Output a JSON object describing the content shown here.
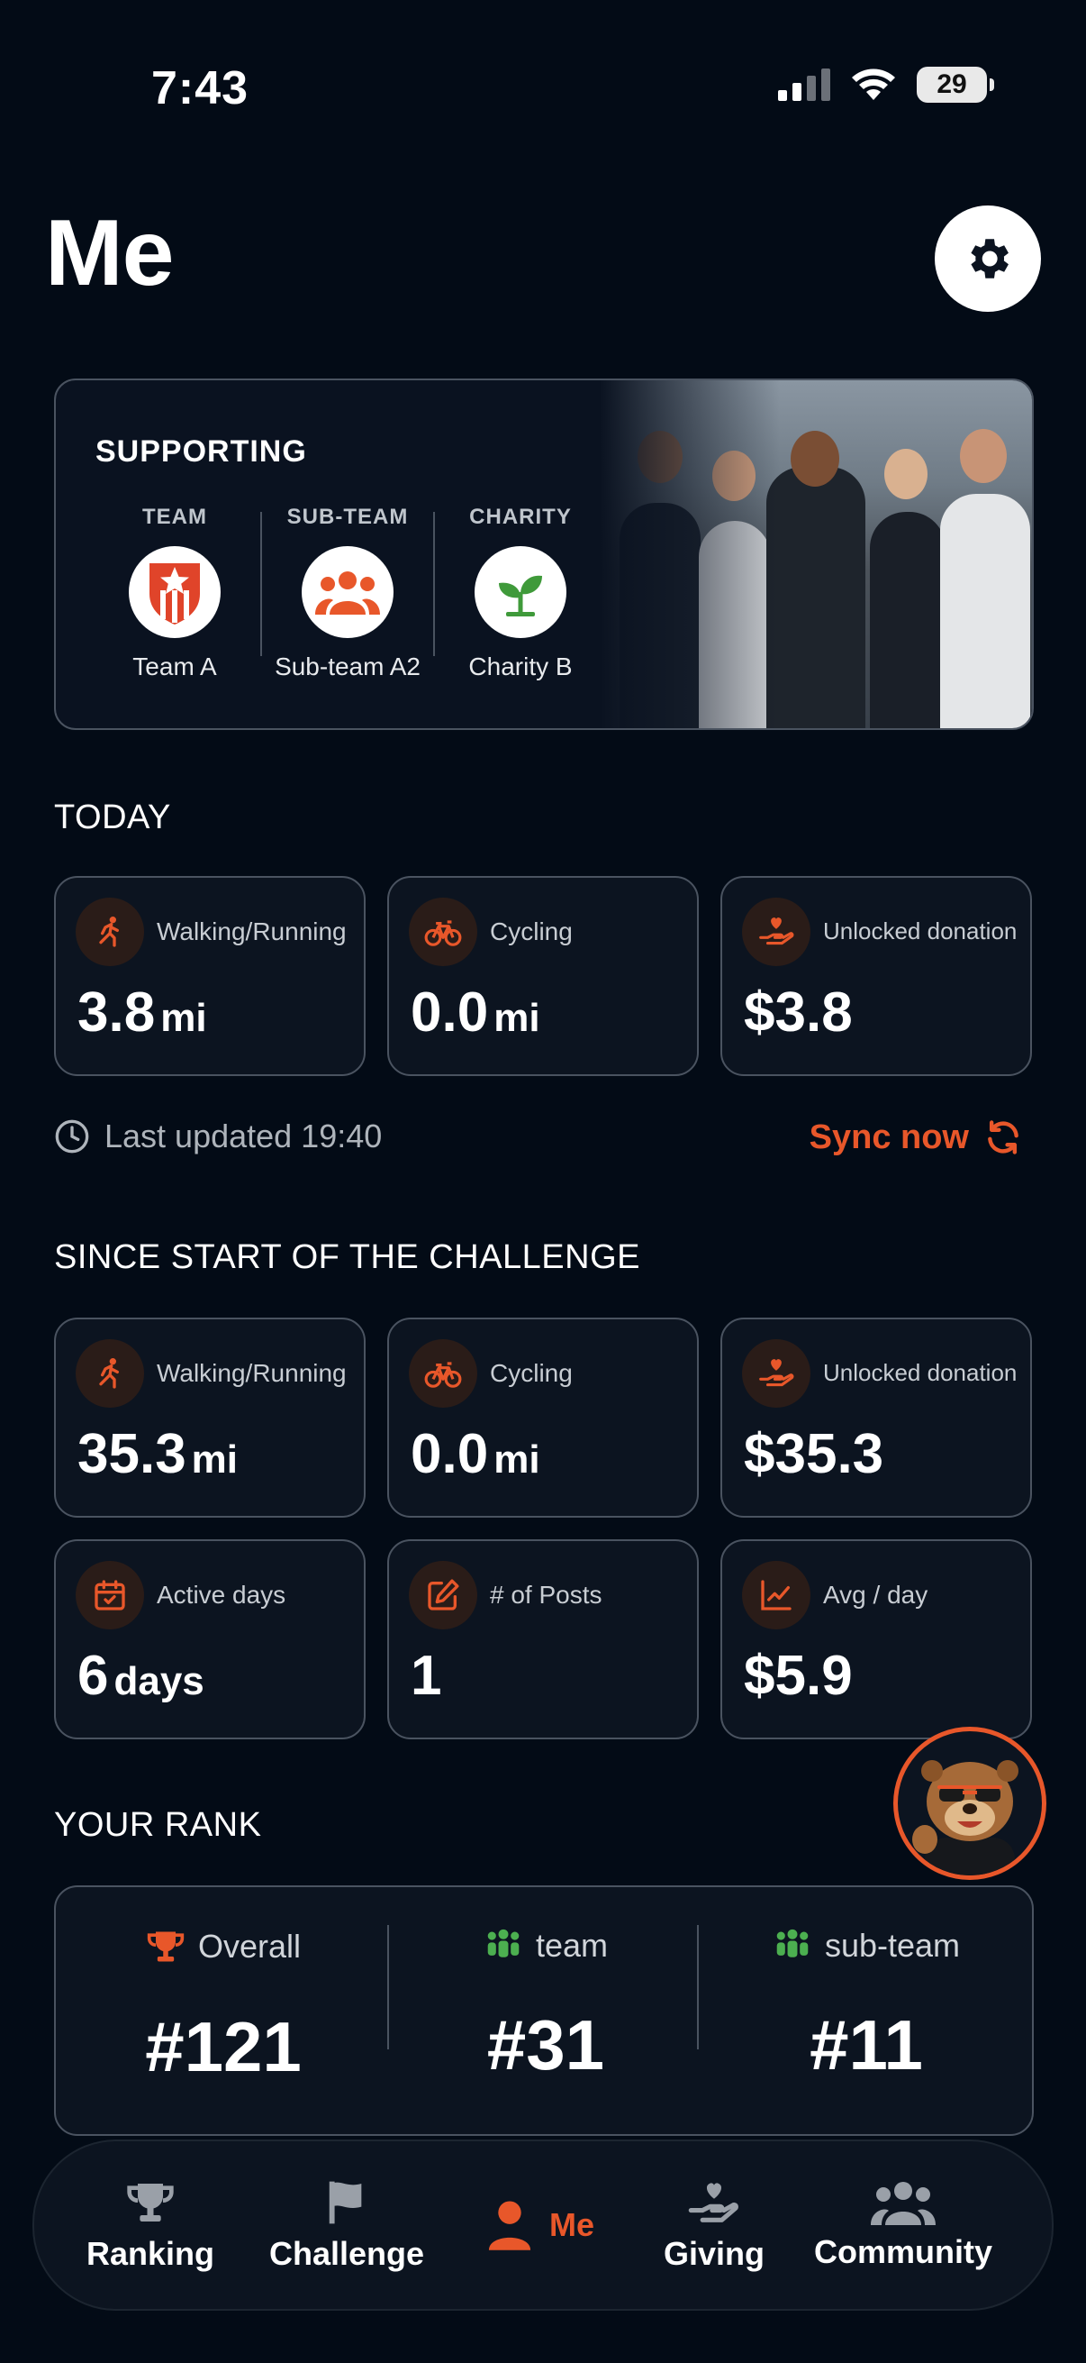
{
  "status": {
    "time": "7:43",
    "battery": "29"
  },
  "header": {
    "title": "Me"
  },
  "supporting": {
    "label": "SUPPORTING",
    "items": [
      {
        "caption": "TEAM",
        "name": "Team A"
      },
      {
        "caption": "SUB-TEAM",
        "name": "Sub-team A2"
      },
      {
        "caption": "CHARITY",
        "name": "Charity B"
      }
    ]
  },
  "today": {
    "heading": "TODAY",
    "stats": [
      {
        "label": "Walking/Running",
        "value": "3.8",
        "unit": "mi"
      },
      {
        "label": "Cycling",
        "value": "0.0",
        "unit": "mi"
      },
      {
        "label": "Unlocked donation",
        "value": "$3.8",
        "unit": ""
      }
    ],
    "updated": "Last updated 19:40",
    "sync": "Sync now"
  },
  "since": {
    "heading": "SINCE START OF THE CHALLENGE",
    "stats": [
      {
        "label": "Walking/Running",
        "value": "35.3",
        "unit": "mi"
      },
      {
        "label": "Cycling",
        "value": "0.0",
        "unit": "mi"
      },
      {
        "label": "Unlocked donation",
        "value": "$35.3",
        "unit": ""
      },
      {
        "label": "Active days",
        "value": "6",
        "unit": "days"
      },
      {
        "label": "# of Posts",
        "value": "1",
        "unit": ""
      },
      {
        "label": "Avg / day",
        "value": "$5.9",
        "unit": ""
      }
    ]
  },
  "rank": {
    "heading": "YOUR RANK",
    "items": [
      {
        "label": "Overall",
        "value": "#121"
      },
      {
        "label": "team",
        "value": "#31"
      },
      {
        "label": "sub-team",
        "value": "#11"
      }
    ]
  },
  "nav": {
    "items": [
      {
        "label": "Ranking"
      },
      {
        "label": "Challenge"
      },
      {
        "label": "Me"
      },
      {
        "label": "Giving"
      },
      {
        "label": "Community"
      }
    ]
  },
  "colors": {
    "accent": "#e8572a",
    "green": "#4caf50",
    "background": "#030b16",
    "card": "#0c1420"
  }
}
